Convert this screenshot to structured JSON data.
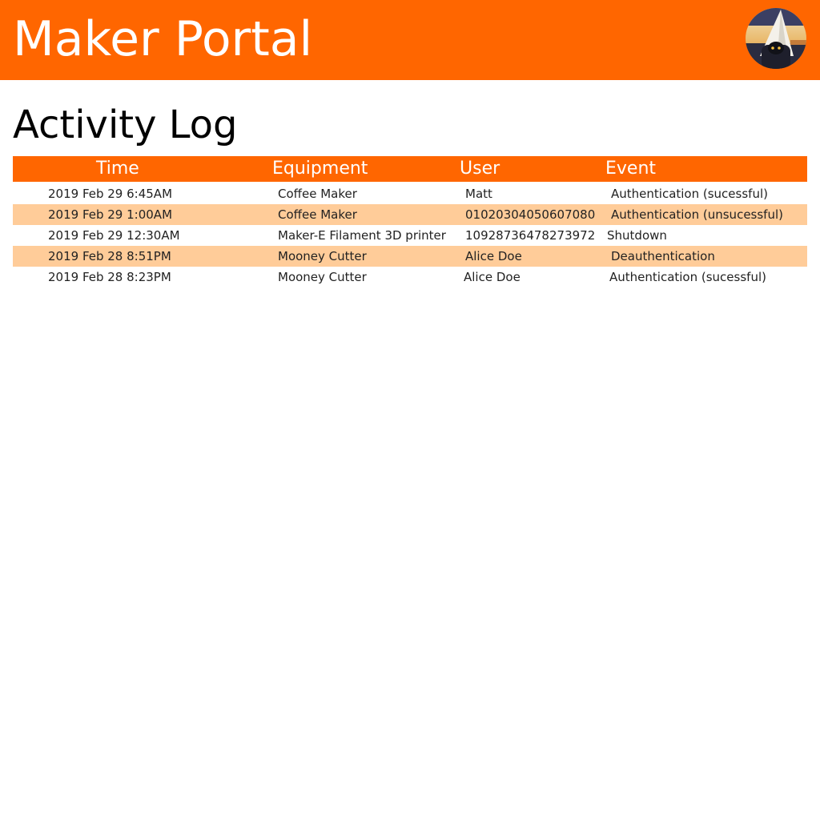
{
  "header": {
    "app_title": "Maker Portal",
    "brand_color": "#ff6600",
    "avatar_icon": "user-avatar-icon"
  },
  "page": {
    "title": "Activity Log"
  },
  "table": {
    "columns": [
      "Time",
      "Equipment",
      "User",
      "Event"
    ],
    "rows": [
      {
        "time": "2019 Feb 29 6:45AM",
        "equipment": "Coffee Maker",
        "user": "Matt",
        "event": "Authentication (sucessful)"
      },
      {
        "time": "2019 Feb 29 1:00AM",
        "equipment": "Coffee Maker",
        "user": "01020304050607080",
        "event": "Authentication (unsucessful)"
      },
      {
        "time": "2019 Feb 29 12:30AM",
        "equipment": "Maker-E Filament 3D printer",
        "user": "10928736478273972",
        "event": "Shutdown"
      },
      {
        "time": "2019 Feb 28 8:51PM",
        "equipment": "Mooney Cutter",
        "user": "Alice Doe",
        "event": "Deauthentication"
      },
      {
        "time": "2019 Feb 28 8:23PM",
        "equipment": "Mooney Cutter",
        "user": "Alice Doe",
        "event": "Authentication (sucessful)"
      }
    ],
    "stripe_color": "#ffcc99"
  }
}
